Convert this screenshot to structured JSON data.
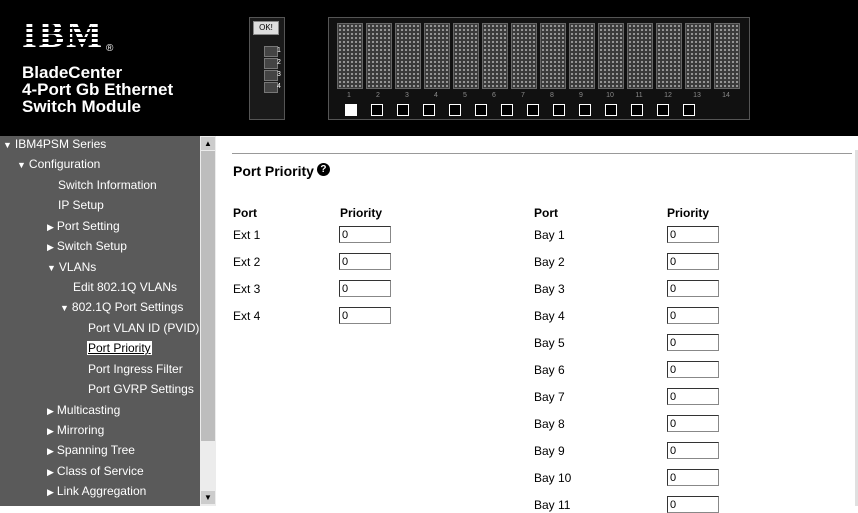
{
  "branding": {
    "logo": "IBM",
    "product_lines": [
      "BladeCenter",
      "4-Port Gb Ethernet",
      "Switch Module"
    ]
  },
  "module_panel": {
    "ok_label": "OK!",
    "ports": [
      "1",
      "2",
      "3",
      "4"
    ]
  },
  "chassis": {
    "bays": [
      "1",
      "2",
      "3",
      "4",
      "5",
      "6",
      "7",
      "8",
      "9",
      "10",
      "11",
      "12",
      "13",
      "14"
    ],
    "selected_index": 0
  },
  "nav": {
    "root": "IBM4PSM Series",
    "configuration": "Configuration",
    "switch_information": "Switch Information",
    "ip_setup": "IP Setup",
    "port_setting": "Port Setting",
    "switch_setup": "Switch Setup",
    "vlans": "VLANs",
    "edit_vlans": "Edit 802.1Q VLANs",
    "port_settings_8021q": "802.1Q Port Settings",
    "port_vlan_id": "Port VLAN ID (PVID)",
    "port_priority": "Port Priority",
    "port_ingress_filter": "Port Ingress Filter",
    "port_gvrp_settings": "Port GVRP Settings",
    "multicasting": "Multicasting",
    "mirroring": "Mirroring",
    "spanning_tree": "Spanning Tree",
    "class_of_service": "Class of Service",
    "link_aggregation": "Link Aggregation"
  },
  "page": {
    "title": "Port Priority",
    "col_port": "Port",
    "col_priority": "Priority",
    "ext_ports": [
      {
        "port": "Ext 1",
        "priority": "0"
      },
      {
        "port": "Ext 2",
        "priority": "0"
      },
      {
        "port": "Ext 3",
        "priority": "0"
      },
      {
        "port": "Ext 4",
        "priority": "0"
      }
    ],
    "bay_ports": [
      {
        "port": "Bay 1",
        "priority": "0"
      },
      {
        "port": "Bay 2",
        "priority": "0"
      },
      {
        "port": "Bay 3",
        "priority": "0"
      },
      {
        "port": "Bay 4",
        "priority": "0"
      },
      {
        "port": "Bay 5",
        "priority": "0"
      },
      {
        "port": "Bay 6",
        "priority": "0"
      },
      {
        "port": "Bay 7",
        "priority": "0"
      },
      {
        "port": "Bay 8",
        "priority": "0"
      },
      {
        "port": "Bay 9",
        "priority": "0"
      },
      {
        "port": "Bay 10",
        "priority": "0"
      },
      {
        "port": "Bay 11",
        "priority": "0"
      }
    ]
  }
}
